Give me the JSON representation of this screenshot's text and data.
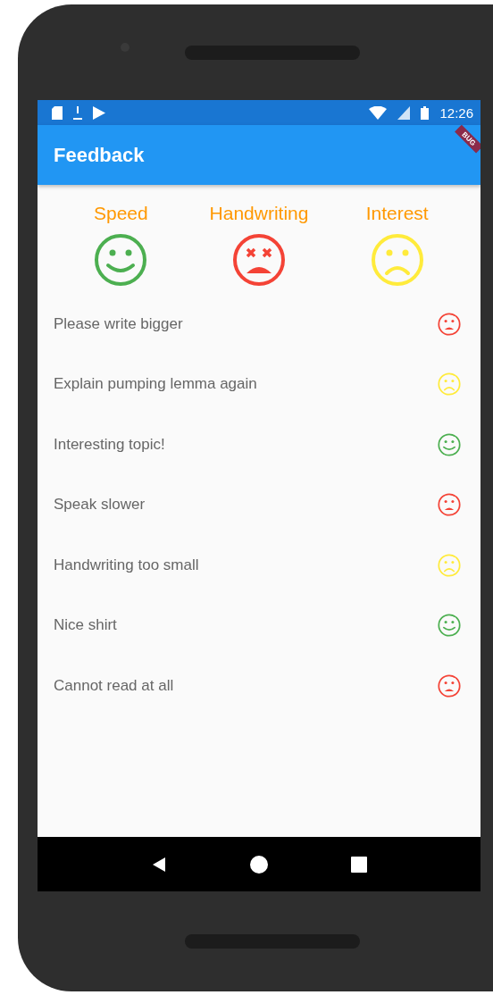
{
  "status_bar": {
    "time": "12:26"
  },
  "debug_banner": {
    "label": "BUG"
  },
  "app_bar": {
    "title": "Feedback"
  },
  "summary": [
    {
      "label": "Speed",
      "kind": "happy"
    },
    {
      "label": "Handwriting",
      "kind": "dead"
    },
    {
      "label": "Interest",
      "kind": "sad"
    }
  ],
  "comments": [
    {
      "text": "Please write bigger",
      "kind": "upset"
    },
    {
      "text": "Explain pumping lemma again",
      "kind": "sad"
    },
    {
      "text": "Interesting topic!",
      "kind": "happy"
    },
    {
      "text": "Speak slower",
      "kind": "upset"
    },
    {
      "text": "Handwriting too small",
      "kind": "sad"
    },
    {
      "text": "Nice shirt",
      "kind": "happy"
    },
    {
      "text": "Cannot read at all",
      "kind": "upset"
    }
  ]
}
